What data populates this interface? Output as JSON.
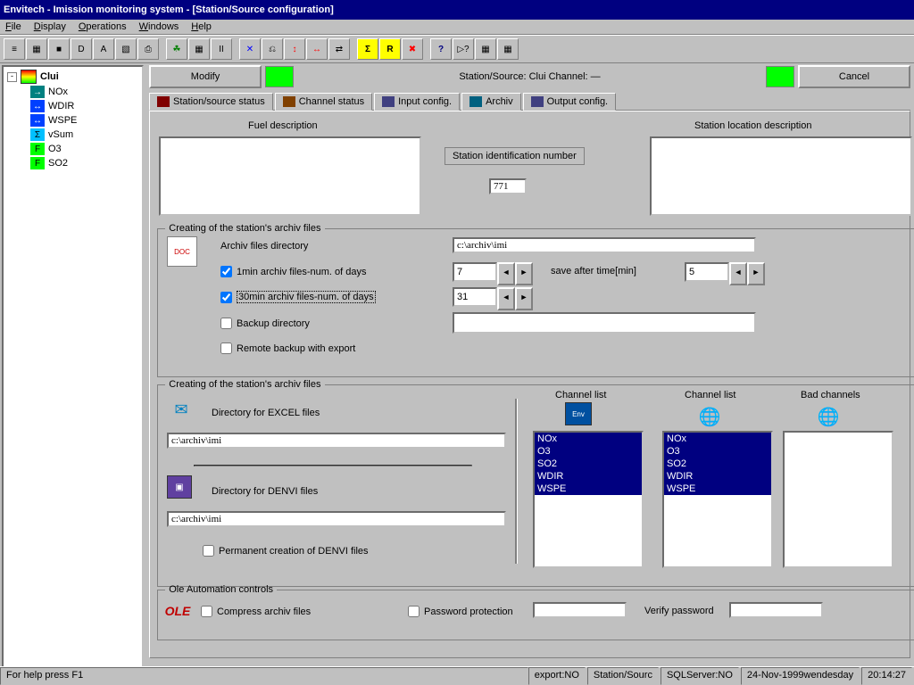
{
  "title": "Envitech - Imission  monitoring system - [Station/Source configuration]",
  "menu": {
    "file": "File",
    "display": "Display",
    "operations": "Operations",
    "windows": "Windows",
    "help": "Help"
  },
  "toolbar": [
    "≡",
    "▦",
    "■",
    "D",
    "A",
    "▧",
    "⎙",
    "",
    "☘",
    "▦",
    "II",
    "",
    "✕",
    "⎌",
    "↕",
    "↔",
    "⇄",
    "",
    "Σ",
    "R",
    "✖",
    "",
    "?",
    "▷?",
    "▦",
    "▦"
  ],
  "tree": {
    "root": "Clui",
    "children": [
      {
        "ico": "arrow",
        "label": "NOx"
      },
      {
        "ico": "blue",
        "label": "WDIR"
      },
      {
        "ico": "blue",
        "label": "WSPE"
      },
      {
        "ico": "sigma",
        "label": "vSum"
      },
      {
        "ico": "f",
        "label": "O3"
      },
      {
        "ico": "f",
        "label": "SO2"
      }
    ]
  },
  "header": {
    "modify": "Modify",
    "status": "Station/Source: Clui  Channel: —",
    "cancel": "Cancel"
  },
  "tabs": {
    "t1": "Station/source status",
    "t2": "Channel status",
    "t3": "Input config.",
    "t4": "Archiv",
    "t5": "Output config."
  },
  "labels": {
    "fuel": "Fuel description",
    "stationloc": "Station location description",
    "sin": "Station identification number",
    "sin_val": "771",
    "fs1": "Creating of the station's archiv files",
    "archdir": "Archiv files directory",
    "archdir_val": "c:\\archiv\\imi",
    "chk1": "1min archiv files-num. of days",
    "chk1_val": "7",
    "saveafter": "save after time[min]",
    "saveafter_val": "5",
    "chk2": "30min archiv files-num. of days",
    "chk2_val": "31",
    "chk3": "Backup directory",
    "chk3_val": "",
    "chk4": "Remote backup with export",
    "fs2": "Creating of the station's archiv files",
    "excel": "Directory for EXCEL files",
    "excel_val": "c:\\archiv\\imi",
    "denvi": "Directory for DENVI files",
    "denvi_val": "c:\\archiv\\imi",
    "chk5": "Permanent creation of  DENVI files",
    "chanlist": "Channel list",
    "chanlist2": "Channel list",
    "badch": "Bad channels",
    "fs3": "Ole Automation controls",
    "chk6": "Compress archiv files",
    "chk7": "Password protection",
    "vpwd": "Verify password"
  },
  "channels": [
    "NOx",
    "O3",
    "SO2",
    "WDIR",
    "WSPE"
  ],
  "status": {
    "help": "For help press F1",
    "export": "export:NO",
    "ss": "Station/Sourc",
    "sql": "SQLServer:NO",
    "date": "24-Nov-1999wendesday",
    "time": "20:14:27"
  }
}
